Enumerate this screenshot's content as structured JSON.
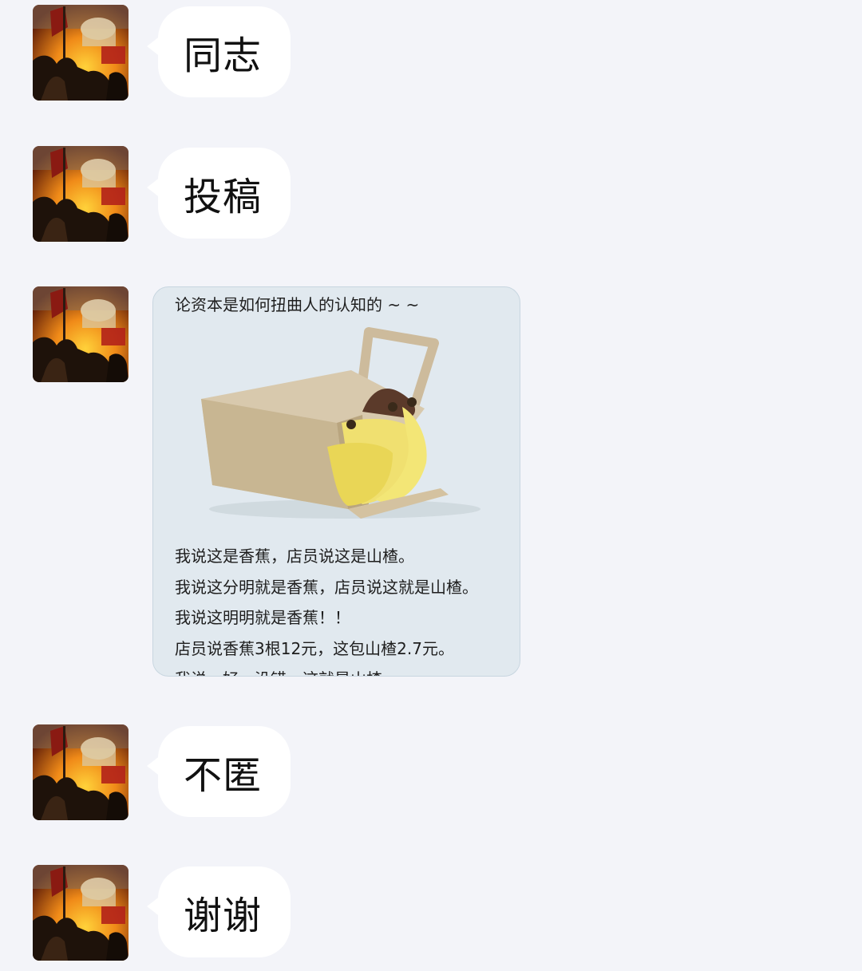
{
  "messages": [
    {
      "text": "同志"
    },
    {
      "text": "投稿"
    },
    {
      "card": {
        "title": "论资本是如何扭曲人的认知的 ~ ~",
        "lines": [
          "我说这是香蕉，店员说这是山楂。",
          "我说这分明就是香蕉，店员说这就是山楂。",
          "我说这明明就是香蕉！！",
          "店员说香蕉3根12元，这包山楂2.7元。",
          "我说，好，没错，这就是山楂。"
        ]
      }
    },
    {
      "text": "不匿"
    },
    {
      "text": "谢谢"
    }
  ],
  "colors": {
    "background": "#f3f4f9",
    "bubble": "#ffffff",
    "card_bg": "#e1e9ef"
  },
  "avatar_icon": "avatar-painting-icon"
}
